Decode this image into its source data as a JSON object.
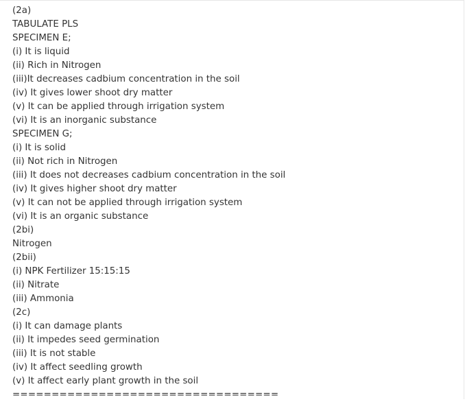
{
  "document": {
    "lines": [
      "(2a)",
      "TABULATE PLS",
      "SPECIMEN E;",
      "(i) It is liquid",
      "(ii) Rich in Nitrogen",
      "(iii)It decreases cadbium concentration in the soil",
      "(iv) It gives lower shoot dry matter",
      "(v) It can be applied through irrigation system",
      "(vi) It is an inorganic substance",
      "SPECIMEN G;",
      "(i) It is solid",
      "(ii) Not rich in Nitrogen",
      "(iii) It does not decreases cadbium concentration in the soil",
      "(iv) It gives higher shoot dry matter",
      "(v) It can not be applied through irrigation system",
      "(vi) It is an organic substance",
      "(2bi)",
      "Nitrogen",
      "(2bii)",
      "(i) NPK Fertilizer 15:15:15",
      "(ii) Nitrate",
      "(iii) Ammonia",
      "(2c)",
      "(i) It can damage plants",
      "(ii) It impedes seed germination",
      "(iii) It is not stable",
      "(iv) It affect seedling growth",
      "(v) It affect early plant growth in the soil",
      "=================================="
    ]
  }
}
